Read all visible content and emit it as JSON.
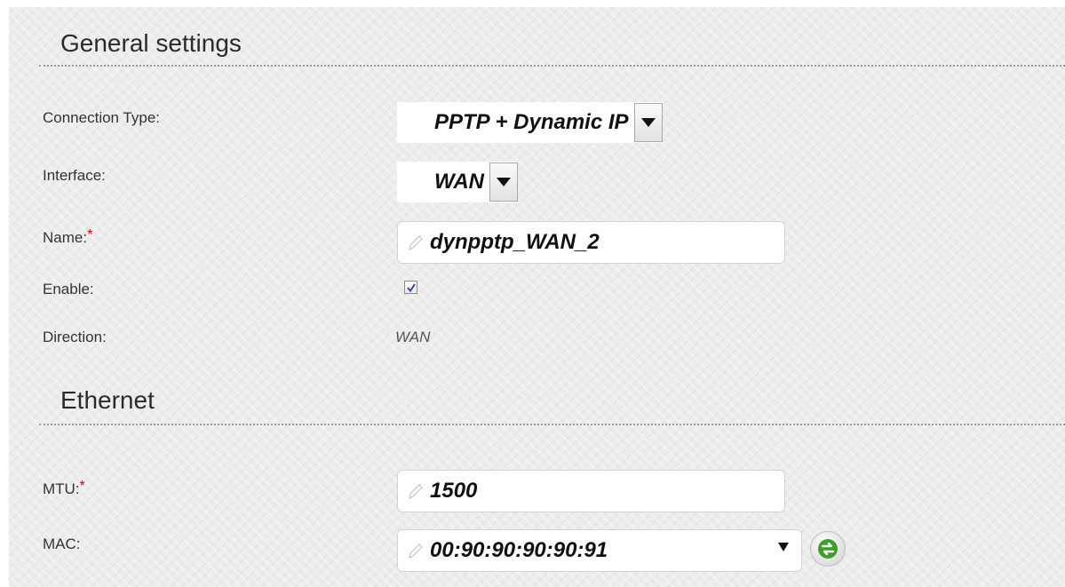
{
  "general": {
    "title": "General settings",
    "connection_type_label": "Connection Type:",
    "connection_type_value": "PPTP + Dynamic IP",
    "interface_label": "Interface:",
    "interface_value": "WAN",
    "name_label": "Name:",
    "name_value": "dynpptp_WAN_2",
    "enable_label": "Enable:",
    "enable_checked": true,
    "direction_label": "Direction:",
    "direction_value": "WAN"
  },
  "ethernet": {
    "title": "Ethernet",
    "mtu_label": "MTU:",
    "mtu_value": "1500",
    "mac_label": "MAC:",
    "mac_value": "00:90:90:90:90:91"
  },
  "required_mark": "*",
  "icons": {
    "pencil": "pencil-icon",
    "dropdown": "chevron-down-icon",
    "refresh": "refresh-icon",
    "checkmark": "checkmark-icon"
  },
  "colors": {
    "required": "#e00000",
    "refresh_green": "#3aa02a"
  }
}
